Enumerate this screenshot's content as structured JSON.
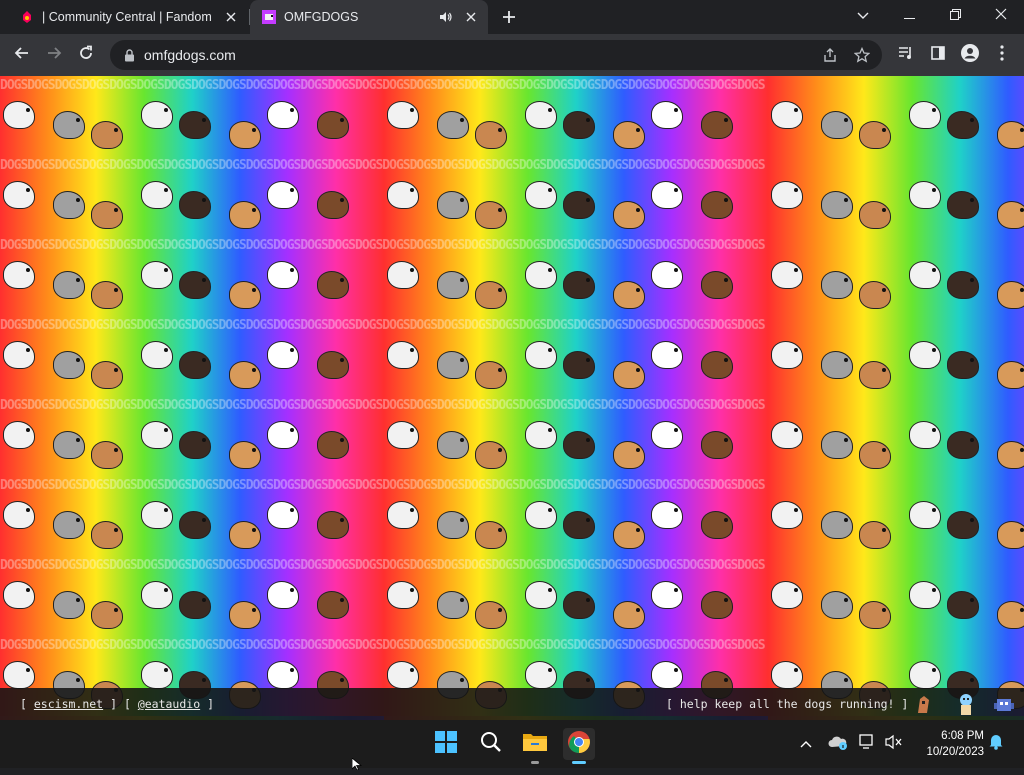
{
  "tabs": [
    {
      "title": "| Community Central | Fandom",
      "favicon": "fandom-icon",
      "active": false
    },
    {
      "title": "OMFGDOGS",
      "favicon": "omfgdogs-icon",
      "active": true
    }
  ],
  "toolbar": {
    "url": "omfgdogs.com"
  },
  "page": {
    "pattern_text": "DOGSDOGSDOGSDOGSDOGSDOGSDOGSDOGSDOGSDOGSDOGSDOGSDOGSDOGSDOGSDOGSDOGSDOGSDOGSDOGSDOGSDOGSDOGSDOGSDOGSDOGSDOGSDOGS"
  },
  "footer": {
    "bracket_open": "[",
    "bracket_close": "]",
    "link_1": "escism.net",
    "link_2": "@eataudio",
    "right_text": "[ help keep all the dogs running! ]"
  },
  "taskbar": {
    "time": "6:08 PM",
    "date": "10/20/2023"
  },
  "colors": {
    "chrome_dark": "#202124",
    "chrome_toolbar": "#35363a",
    "taskbar_bg": "#1c1c1c",
    "accent": "#60cdff"
  }
}
